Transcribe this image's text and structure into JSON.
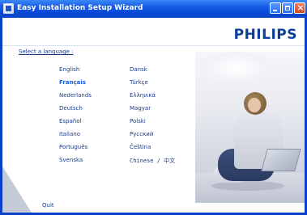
{
  "window": {
    "title": "Easy Installation Setup Wizard"
  },
  "brand": {
    "name": "PHILIPS"
  },
  "main": {
    "select_label": "Select a language :",
    "languages_col1": [
      "English",
      "Français",
      "Nederlands",
      "Deutsch",
      "Español",
      "Italiano",
      "Português",
      "Svenska"
    ],
    "languages_col2": [
      "Dansk",
      "Türkçe",
      "Ελληνικά",
      "Magyar",
      "Polski",
      "Русский",
      "Čeština",
      "Chinese / 中文"
    ],
    "selected_language": "Français"
  },
  "footer": {
    "quit_label": "Quit"
  },
  "colors": {
    "title_bar": "#1a5ee8",
    "brand": "#0b3f9a",
    "link": "#1a3a8a",
    "selected": "#1a5ee0"
  },
  "icons": {
    "app": "setup-wizard-icon",
    "minimize": "minimize-icon",
    "maximize": "maximize-icon",
    "close": "close-icon"
  }
}
